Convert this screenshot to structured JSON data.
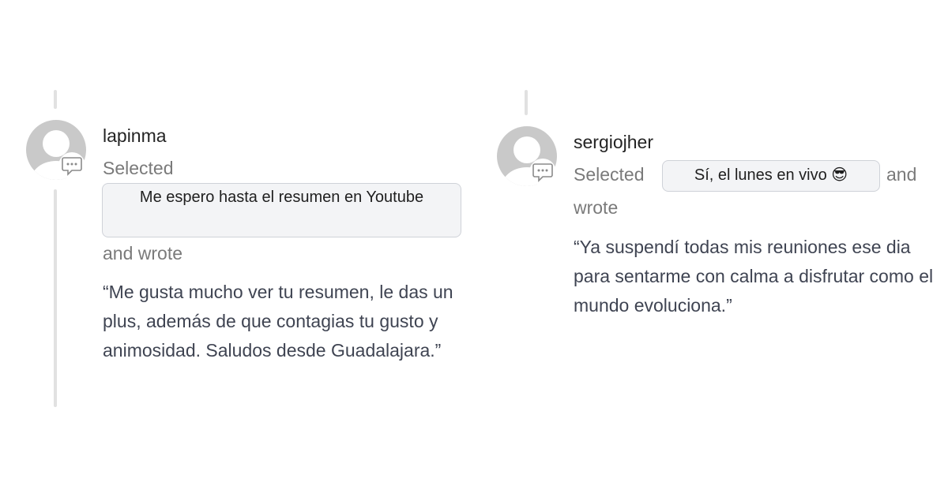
{
  "comments": [
    {
      "username": "lapinma",
      "selected_label": "Selected",
      "selection": "Me espero hasta el resumen en Youtube",
      "wrote_label": "and wrote",
      "quote": "“Me gusta mucho ver tu resumen, le das un plus, además de que contagias tu gusto y animosidad. Saludos desde Guadalajara.”",
      "icons": {
        "avatar": "default-user-avatar-icon",
        "badge": "comment-bubble-icon"
      }
    },
    {
      "username": "sergiojher",
      "selected_label": "Selected",
      "selection": "Sí, el lunes en vivo 😎",
      "and_label": "and",
      "wrote_label": "wrote",
      "quote": "“Ya suspendí todas mis reuniones ese dia para sentarme con calma a disfrutar como el mundo evoluciona.”",
      "icons": {
        "avatar": "default-user-avatar-icon",
        "badge": "comment-bubble-icon"
      }
    }
  ],
  "colors": {
    "avatar": "#c9c9c9",
    "thread_line": "#e1e1e1",
    "chip_bg": "#f3f4f6",
    "chip_border": "#cfd2d8",
    "meta_text": "#7a7a7a",
    "quote_text": "#3f4452",
    "username_text": "#242424"
  }
}
